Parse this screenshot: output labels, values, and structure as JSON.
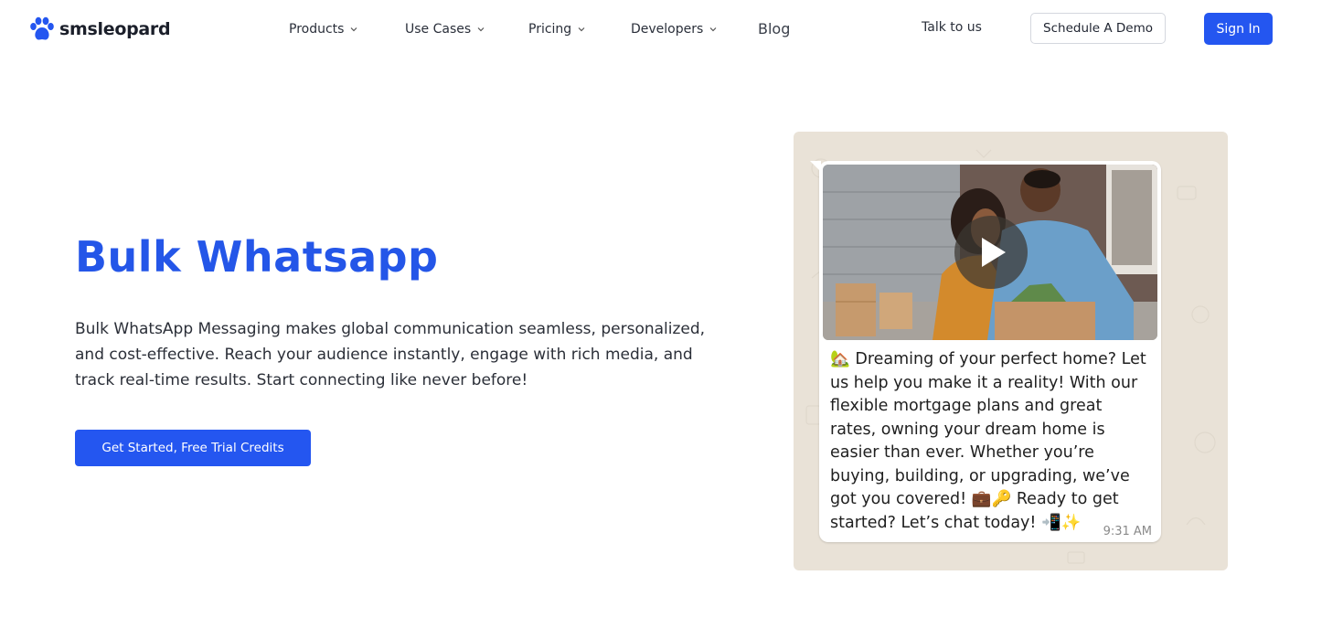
{
  "header": {
    "logo_text": "smsleopard",
    "logo_icon": "paw-icon",
    "nav": [
      {
        "label": "Products",
        "has_dropdown": true
      },
      {
        "label": "Use Cases",
        "has_dropdown": true
      },
      {
        "label": "Pricing",
        "has_dropdown": true
      },
      {
        "label": "Developers",
        "has_dropdown": true
      },
      {
        "label": "Blog",
        "has_dropdown": false
      }
    ],
    "talk_label": "Talk to us",
    "demo_label": "Schedule A Demo",
    "signin_label": "Sign In"
  },
  "hero": {
    "title": "Bulk Whatsapp",
    "description": "Bulk WhatsApp Messaging makes global communication seamless, personalized, and cost-effective. Reach your audience instantly, engage with rich media, and track real-time results. Start connecting like never before!",
    "cta_label": "Get Started, Free Trial Credits"
  },
  "chat": {
    "message": "🏡 Dreaming of your perfect home? Let us help you make it a reality! With our flexible mortgage plans and great rates, owning your dream home is easier than ever. Whether you’re buying, building, or upgrading, we’ve got you covered! 💼🔑 Ready to get started? Let’s chat today! 📲✨",
    "time": "9:31 AM"
  },
  "colors": {
    "brand_blue": "#2456f0",
    "chat_bg": "#e9e2d7"
  }
}
